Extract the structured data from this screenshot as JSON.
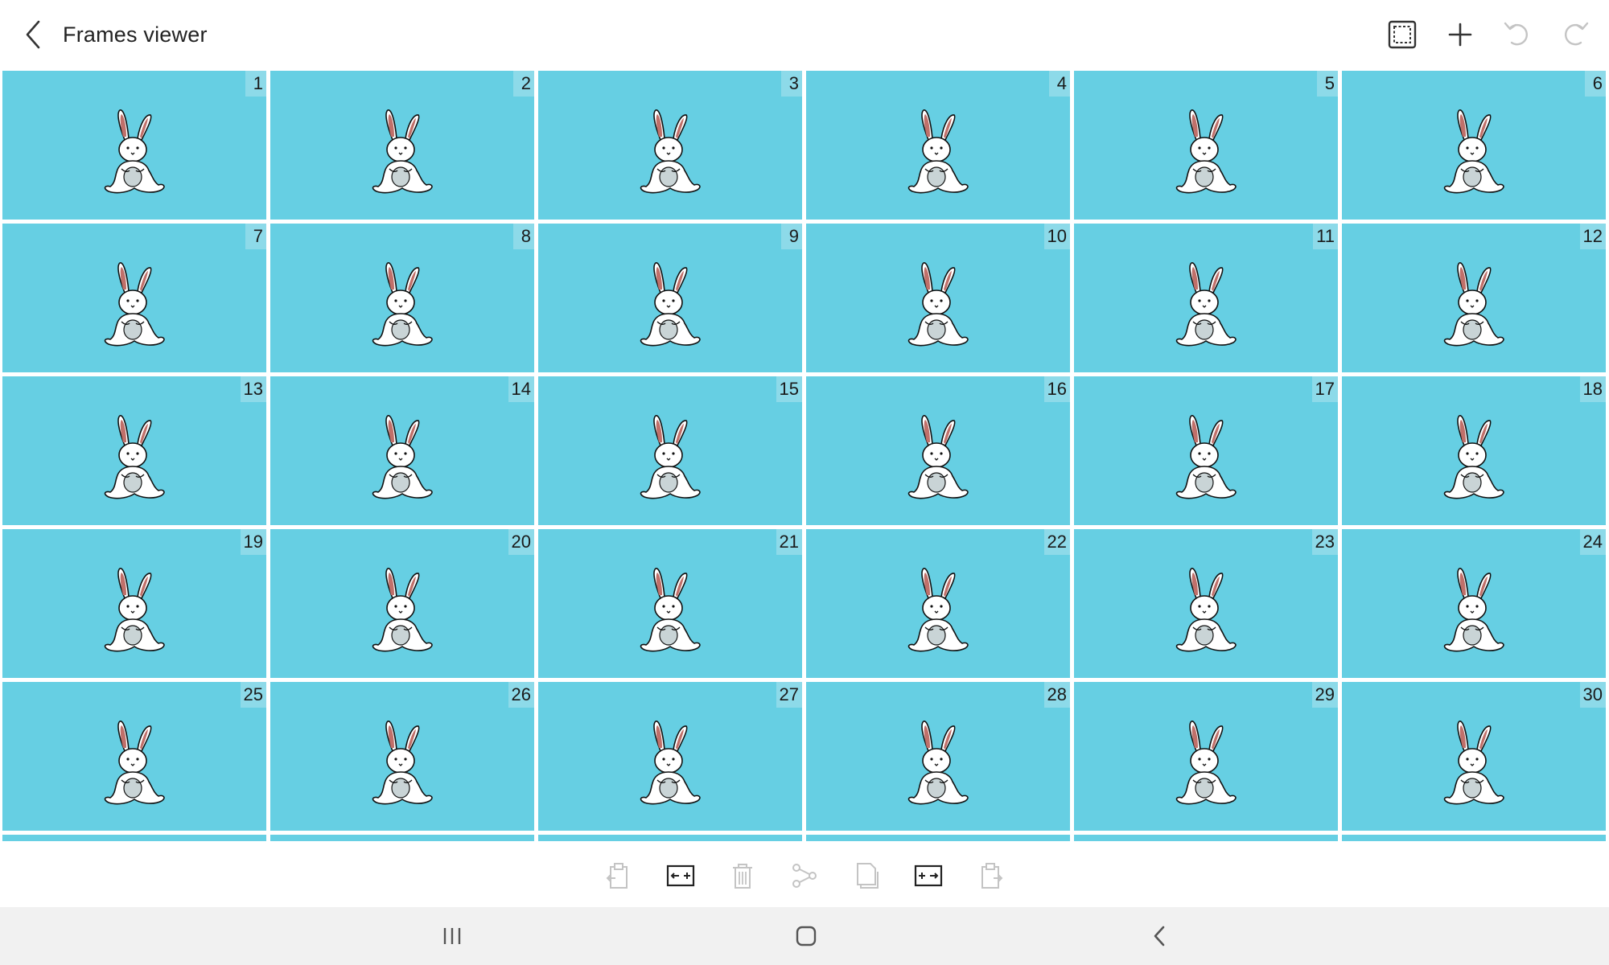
{
  "header": {
    "title": "Frames viewer",
    "icons": [
      "back-arrow-icon",
      "select-frame-icon",
      "add-icon",
      "undo-icon",
      "redo-icon"
    ]
  },
  "frames": [
    "1",
    "2",
    "3",
    "4",
    "5",
    "6",
    "7",
    "8",
    "9",
    "10",
    "11",
    "12",
    "13",
    "14",
    "15",
    "16",
    "17",
    "18",
    "19",
    "20",
    "21",
    "22",
    "23",
    "24",
    "25",
    "26",
    "27",
    "28",
    "29",
    "30"
  ],
  "toolbar": {
    "tools": [
      "paste-before-icon",
      "insert-frame-icon",
      "delete-icon",
      "share-icon",
      "copy-icon",
      "insert-frame-after-icon",
      "paste-after-icon"
    ]
  },
  "navbar": {
    "icons": [
      "recent-apps-icon",
      "home-icon",
      "nav-back-icon"
    ]
  },
  "colors": {
    "frame_background": "#66cfe3",
    "frame_number_background": "#8ddae9",
    "active_icon": "#333333",
    "disabled_icon": "#c4c4c4",
    "ear_inner": "#c0706a"
  }
}
